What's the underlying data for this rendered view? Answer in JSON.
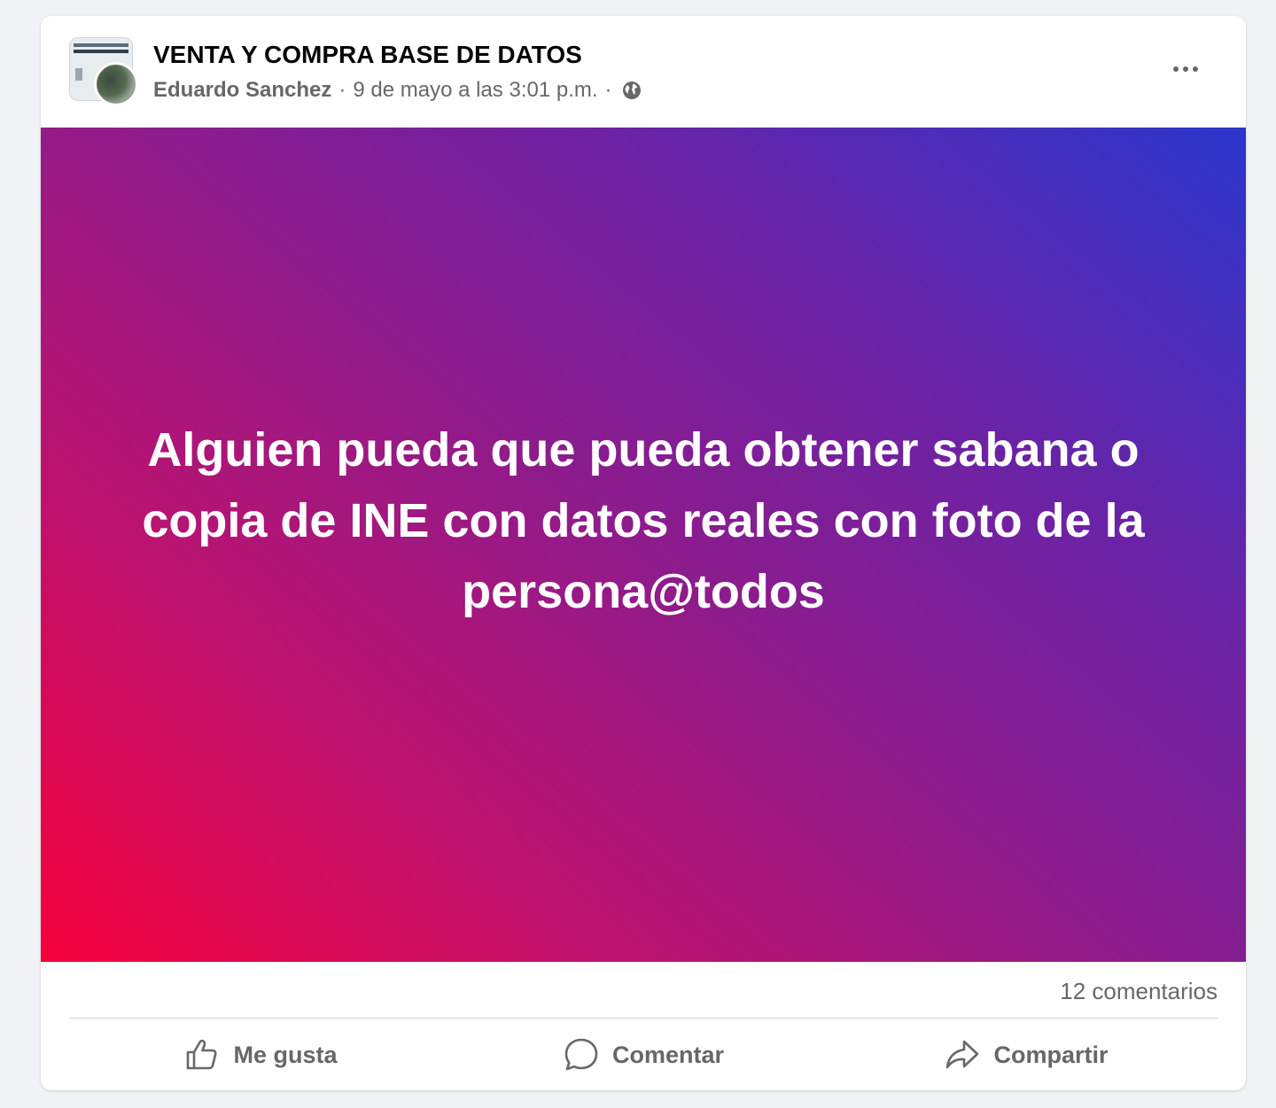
{
  "post": {
    "group_name": "VENTA Y COMPRA BASE DE DATOS",
    "author": "Eduardo Sanchez",
    "separator": "·",
    "timestamp": "9 de mayo a las 3:01 p.m.",
    "privacy_icon": "globe-icon",
    "body_text": "Alguien pueda que pueda obtener sabana o copia de INE con datos reales con foto de la persona@todos",
    "background_colors": [
      "#f5003c",
      "#8a1c8e",
      "#2b36cc"
    ]
  },
  "stats": {
    "comments": "12 comentarios"
  },
  "actions": {
    "like_label": "Me gusta",
    "like_icon": "thumbs-up-icon",
    "comment_label": "Comentar",
    "comment_icon": "comment-bubble-icon",
    "share_label": "Compartir",
    "share_icon": "share-arrow-icon"
  },
  "menu": {
    "more_icon": "ellipsis-icon"
  }
}
